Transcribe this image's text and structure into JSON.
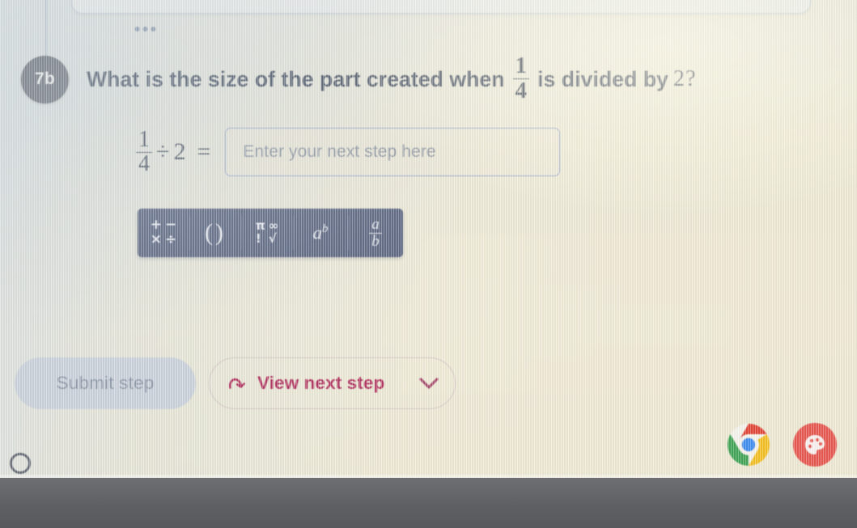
{
  "app": {
    "top_panel_menu": "•••"
  },
  "question": {
    "step_label": "7b",
    "text_before": "What is the size of the part created when",
    "fraction": {
      "numerator": "1",
      "denominator": "4"
    },
    "text_after": "is divided by",
    "divisor": "2",
    "question_mark": "?"
  },
  "equation": {
    "fraction": {
      "numerator": "1",
      "denominator": "4"
    },
    "operator": "÷",
    "operand": "2",
    "equals": "=",
    "input": {
      "value": "",
      "placeholder": "Enter your next step here"
    }
  },
  "math_toolbar": {
    "buttons": [
      {
        "name": "operators",
        "glyphs": [
          "+",
          "−",
          "×",
          "÷"
        ]
      },
      {
        "name": "parentheses",
        "glyphs": [
          "(",
          ")"
        ]
      },
      {
        "name": "symbols",
        "glyphs": [
          "π",
          "∞",
          "!",
          "√"
        ]
      },
      {
        "name": "exponent",
        "base": "a",
        "exponent": "b"
      },
      {
        "name": "fraction",
        "numerator": "a",
        "denominator": "b"
      }
    ]
  },
  "actions": {
    "submit_label": "Submit step",
    "submit_disabled": true,
    "view_next_label": "View next step",
    "view_next_icon": "redo-arrow-icon",
    "chevron_icon": "chevron-down-icon"
  },
  "taskbar": {
    "icons": [
      {
        "name": "chrome-icon"
      },
      {
        "name": "app-red-icon"
      }
    ]
  },
  "colors": {
    "page_background": "#eeead9",
    "step_badge": "#6c6f78",
    "question_text": "#4c5566",
    "input_border": "#94a4c9",
    "toolbar_background": "#5d6782",
    "submit_fill": "#ccd3dd",
    "submit_text": "#8d97a8",
    "accent_magenta": "#b2305f",
    "bezel": "#5f6063"
  }
}
